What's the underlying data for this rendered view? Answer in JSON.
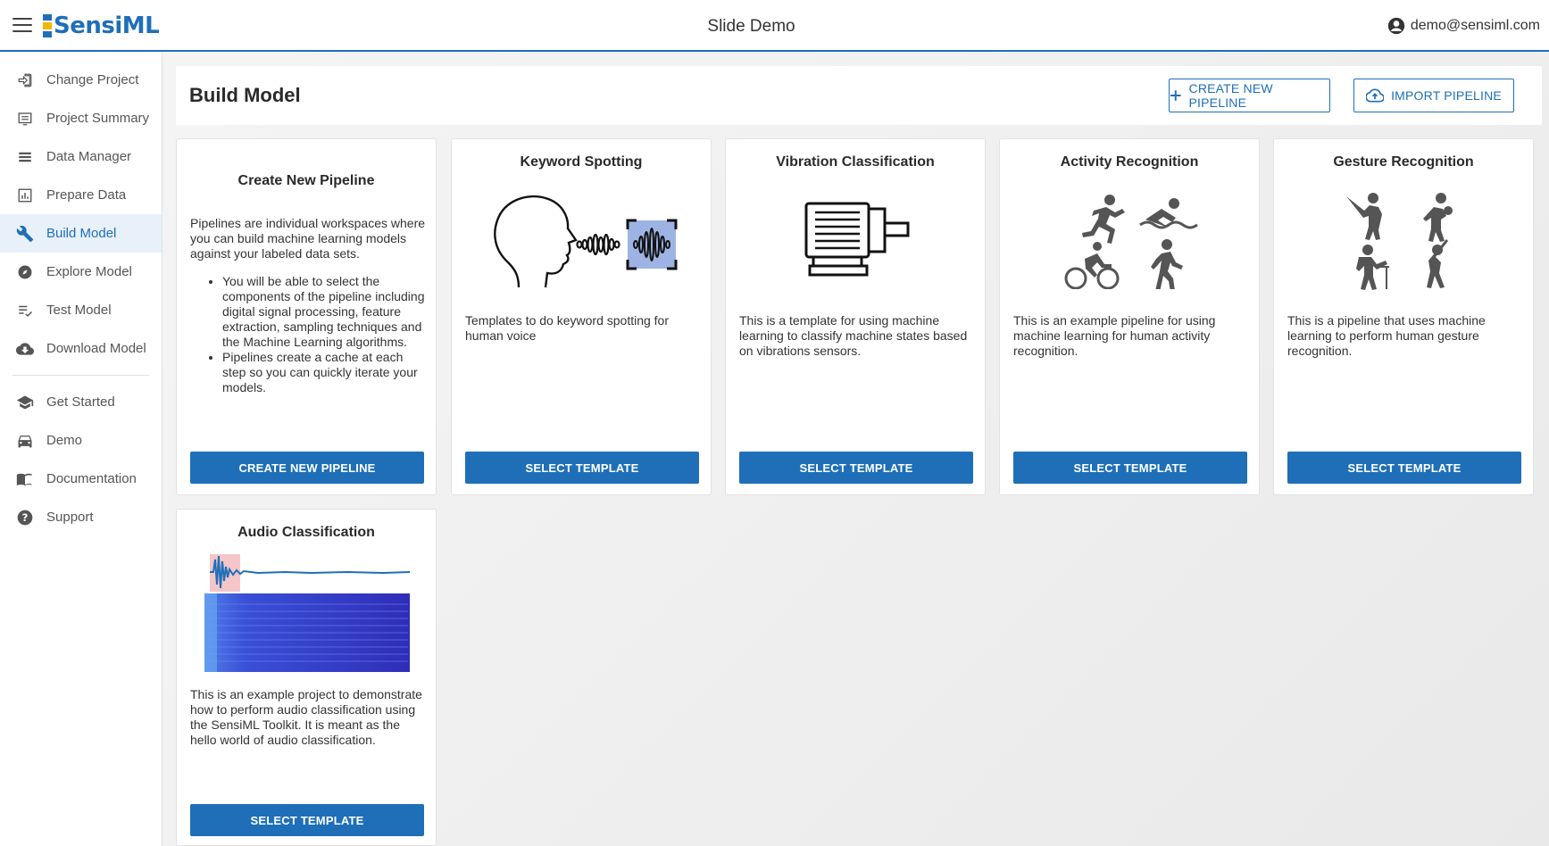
{
  "app": {
    "logo_text": "SensiML",
    "title": "Slide Demo",
    "user_email": "demo@sensiml.com",
    "brand_color": "#1e6fb8",
    "logo_accent_color": "#f2b705"
  },
  "sidebar": {
    "items": [
      {
        "label": "Change Project",
        "icon": "change-project-icon"
      },
      {
        "label": "Project Summary",
        "icon": "summary-icon"
      },
      {
        "label": "Data Manager",
        "icon": "data-manager-icon"
      },
      {
        "label": "Prepare Data",
        "icon": "prepare-data-icon"
      },
      {
        "label": "Build Model",
        "icon": "wrench-icon",
        "active": true
      },
      {
        "label": "Explore Model",
        "icon": "compass-icon"
      },
      {
        "label": "Test Model",
        "icon": "test-list-icon"
      },
      {
        "label": "Download Model",
        "icon": "cloud-download-icon"
      }
    ],
    "secondary": [
      {
        "label": "Get Started",
        "icon": "school-icon"
      },
      {
        "label": "Demo",
        "icon": "car-icon"
      },
      {
        "label": "Documentation",
        "icon": "book-icon"
      },
      {
        "label": "Support",
        "icon": "help-icon"
      }
    ]
  },
  "main": {
    "title": "Build Model",
    "create_button": "CREATE NEW PIPELINE",
    "import_button": "IMPORT PIPELINE"
  },
  "cards": [
    {
      "title": "Create New Pipeline",
      "desc": "Pipelines are individual workspaces where you can build machine learning models against your labeled data sets.",
      "bullets": [
        "You will be able to select the components of the pipeline including digital signal processing, feature extraction, sampling techniques and the Machine Learning algorithms.",
        "Pipelines create a cache at each step so you can quickly iterate your models."
      ],
      "button": "CREATE NEW PIPELINE"
    },
    {
      "title": "Keyword Spotting",
      "desc": "Templates to do keyword spotting for human voice",
      "button": "SELECT TEMPLATE",
      "icon": "head-voice-icon"
    },
    {
      "title": "Vibration Classification",
      "desc": "This is a template for using machine learning to classify machine states based on vibrations sensors.",
      "button": "SELECT TEMPLATE",
      "icon": "motor-icon"
    },
    {
      "title": "Activity Recognition",
      "desc": "This is an example pipeline for using machine learning for human activity recognition.",
      "button": "SELECT TEMPLATE",
      "icon": "activity-icon"
    },
    {
      "title": "Gesture Recognition",
      "desc": "This is a pipeline that uses machine learning to perform human gesture recognition.",
      "button": "SELECT TEMPLATE",
      "icon": "gesture-icon"
    },
    {
      "title": "Audio Classification",
      "desc": "This is an example project to demonstrate how to perform audio classification using the SensiML Toolkit. It is meant as the hello world of audio classification.",
      "button": "SELECT TEMPLATE",
      "icon": "spectrogram-image"
    }
  ]
}
